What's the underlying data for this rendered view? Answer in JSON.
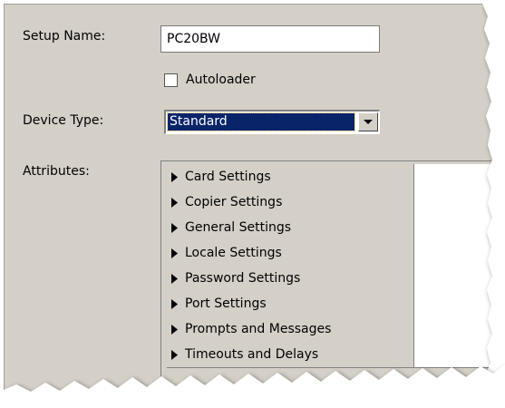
{
  "form": {
    "setup_name_label": "Setup Name:",
    "setup_name_value": "PC20BW",
    "autoloader_label": "Autoloader",
    "autoloader_checked": false,
    "device_type_label": "Device Type:",
    "device_type_value": "Standard",
    "attributes_label": "Attributes:"
  },
  "attributes": [
    {
      "label": "Card Settings"
    },
    {
      "label": "Copier Settings"
    },
    {
      "label": "General Settings"
    },
    {
      "label": "Locale Settings"
    },
    {
      "label": "Password Settings"
    },
    {
      "label": "Port Settings"
    },
    {
      "label": "Prompts and Messages"
    },
    {
      "label": "Timeouts and Delays"
    }
  ],
  "icons": {
    "expand_arrow": "triangle-right",
    "dropdown_arrow": "triangle-down"
  },
  "colors": {
    "panel_bg": "#d4d0c8",
    "selection_bg": "#0a246a",
    "selection_text": "#ffffff"
  }
}
